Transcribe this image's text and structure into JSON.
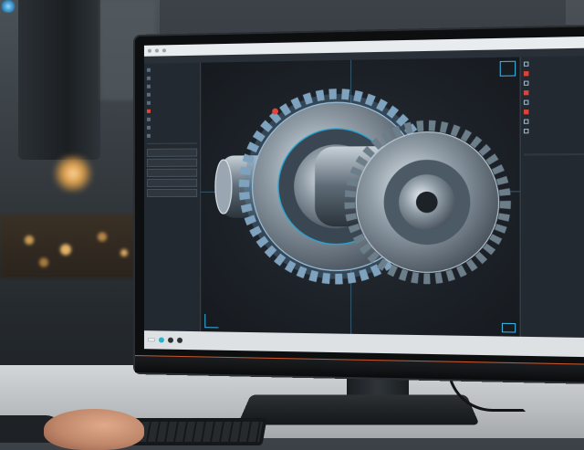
{
  "scene": {
    "description_colors": {
      "accent": "#38b4e6",
      "highlight": "#e0473a",
      "bezel": "#0c0e10",
      "chin_strip": "#c9562c"
    }
  },
  "cad_app": {
    "title": "",
    "menu": [
      "",
      "",
      "",
      "",
      ""
    ],
    "left_panel": {
      "rows": [
        "",
        "",
        "",
        "",
        "",
        "",
        "",
        "",
        ""
      ],
      "highlighted_index": 5,
      "inputs": [
        "",
        "",
        "",
        "",
        ""
      ]
    },
    "viewport": {
      "model": "gear-assembly-icon"
    },
    "right_panel": {
      "tool_rows": [
        "",
        "",
        "",
        "",
        "",
        "",
        "",
        ""
      ],
      "properties_header": "",
      "properties": [
        {
          "k": "",
          "v": ""
        },
        {
          "k": "",
          "v": ""
        },
        {
          "k": "",
          "v": ""
        },
        {
          "k": "",
          "v": ""
        },
        {
          "k": "",
          "v": ""
        },
        {
          "k": "",
          "v": ""
        }
      ]
    },
    "statusbar": {
      "search": "",
      "right_text": ""
    }
  }
}
